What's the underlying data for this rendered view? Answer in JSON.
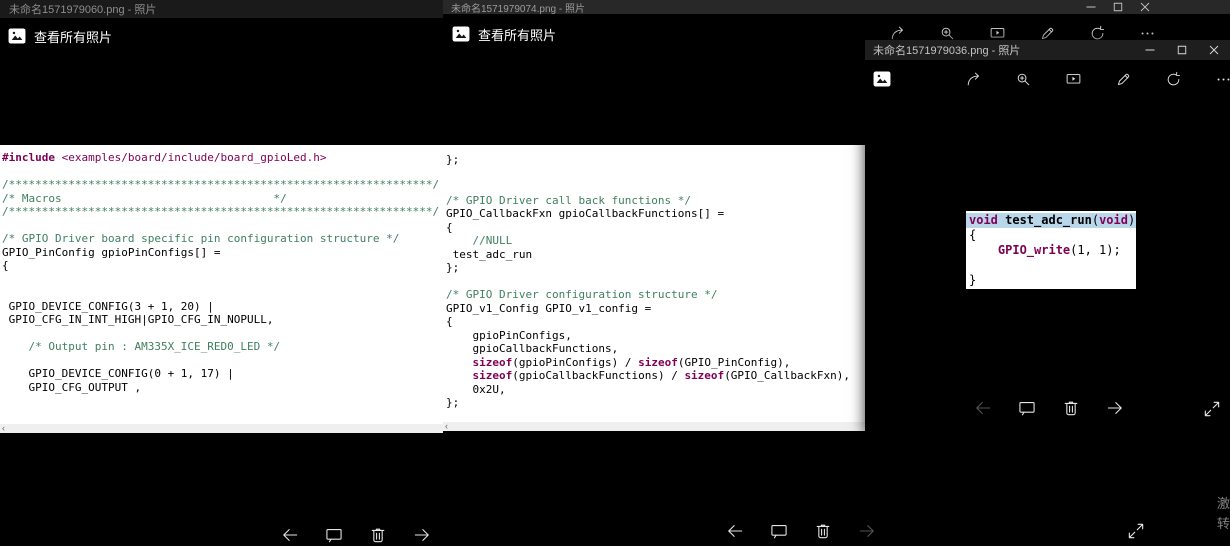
{
  "watermark": {
    "line1": "激活",
    "line2": "转到"
  },
  "colors": {
    "code_comment": "#3f7f5f",
    "code_keyword": "#7f0055",
    "code_plain": "#000000",
    "selection_highlight": "#b9d6ea",
    "photo_bg": "#ffffff",
    "app_bg": "#000000"
  },
  "win1": {
    "title": "未命名1571979060.png - 照片",
    "view_all_label": "查看所有照片",
    "bottom_icons": [
      {
        "n": "back"
      },
      {
        "n": "filmstrip"
      },
      {
        "n": "delete"
      },
      {
        "n": "forward"
      }
    ],
    "code": [
      [
        [
          "k",
          "#include"
        ],
        [
          "m",
          " <examples/board/include/board_gpioLed.h>"
        ]
      ],
      [],
      [
        [
          "c",
          "/****************************************************************/"
        ]
      ],
      [
        [
          "c",
          "/* Macros                                */"
        ]
      ],
      [
        [
          "c",
          "/****************************************************************/"
        ]
      ],
      [],
      [
        [
          "c",
          "/* GPIO Driver board specific pin configuration structure */"
        ]
      ],
      [
        [
          "p",
          "GPIO_PinConfig gpioPinConfigs[] ="
        ]
      ],
      [
        [
          "p",
          "{"
        ]
      ],
      [],
      [],
      [
        [
          "p",
          " GPIO_DEVICE_CONFIG(3 + 1, 20) |"
        ]
      ],
      [
        [
          "p",
          " GPIO_CFG_IN_INT_HIGH|GPIO_CFG_IN_NOPULL,"
        ]
      ],
      [],
      [
        [
          "c",
          "    /* Output pin : AM335X_ICE_RED0_LED */"
        ]
      ],
      [],
      [
        [
          "p",
          "    GPIO_DEVICE_CONFIG(0 + 1, 17) |"
        ]
      ],
      [
        [
          "p",
          "    GPIO_CFG_OUTPUT ,"
        ]
      ]
    ]
  },
  "win2": {
    "title": "未命名1571979074.png - 照片",
    "view_all_label": "查看所有照片",
    "caption_icons": [
      {
        "n": "minimize"
      },
      {
        "n": "maximize"
      },
      {
        "n": "close"
      }
    ],
    "toolbar_icons": [
      {
        "n": "share"
      },
      {
        "n": "zoom"
      },
      {
        "n": "slideshow"
      },
      {
        "n": "edit"
      },
      {
        "n": "rotate"
      },
      {
        "n": "more"
      }
    ],
    "bottom_icons": [
      {
        "n": "back"
      },
      {
        "n": "filmstrip"
      },
      {
        "n": "delete"
      },
      {
        "n": "forward",
        "disabled": true
      }
    ],
    "fullscreen_icon": [
      {
        "n": "fullscreen"
      }
    ],
    "code": [
      [
        [
          "p",
          "};"
        ]
      ],
      [],
      [],
      [
        [
          "c",
          "/* GPIO Driver call back functions */"
        ]
      ],
      [
        [
          "p",
          "GPIO_CallbackFxn gpioCallbackFunctions[] ="
        ]
      ],
      [
        [
          "p",
          "{"
        ]
      ],
      [
        [
          "c",
          "    //NULL"
        ]
      ],
      [
        [
          "p",
          " test_adc_run"
        ]
      ],
      [
        [
          "p",
          "};"
        ]
      ],
      [],
      [
        [
          "c",
          "/* GPIO Driver configuration structure */"
        ]
      ],
      [
        [
          "p",
          "GPIO_v1_Config GPIO_v1_config ="
        ]
      ],
      [
        [
          "p",
          "{"
        ]
      ],
      [
        [
          "p",
          "    gpioPinConfigs,"
        ]
      ],
      [
        [
          "p",
          "    gpioCallbackFunctions,"
        ]
      ],
      [
        [
          "p",
          "    "
        ],
        [
          "k",
          "sizeof"
        ],
        [
          "p",
          "(gpioPinConfigs) / "
        ],
        [
          "k",
          "sizeof"
        ],
        [
          "p",
          "(GPIO_PinConfig),"
        ]
      ],
      [
        [
          "p",
          "    "
        ],
        [
          "k",
          "sizeof"
        ],
        [
          "p",
          "(gpioCallbackFunctions) / "
        ],
        [
          "k",
          "sizeof"
        ],
        [
          "p",
          "(GPIO_CallbackFxn),"
        ]
      ],
      [
        [
          "p",
          "    0x2U,"
        ]
      ],
      [
        [
          "p",
          "};"
        ]
      ]
    ]
  },
  "win3": {
    "title": "未命名1571979036.png - 照片",
    "caption_icons": [
      {
        "n": "minimize"
      },
      {
        "n": "maximize"
      },
      {
        "n": "close"
      }
    ],
    "toolbar_icons": [
      {
        "n": "share"
      },
      {
        "n": "zoom"
      },
      {
        "n": "slideshow"
      },
      {
        "n": "edit"
      },
      {
        "n": "rotate"
      },
      {
        "n": "more"
      }
    ],
    "bottom_icons": [
      {
        "n": "back",
        "disabled": true
      },
      {
        "n": "filmstrip"
      },
      {
        "n": "delete"
      },
      {
        "n": "forward"
      }
    ],
    "fullscreen_icon": [
      {
        "n": "fullscreen"
      }
    ],
    "code": [
      {
        "hl": true,
        "s": [
          [
            "k",
            "void"
          ],
          [
            "b",
            " test_adc_run"
          ],
          [
            "p",
            "("
          ],
          [
            "k",
            "void"
          ],
          [
            "p",
            ")"
          ]
        ]
      },
      [
        [
          "p",
          "{"
        ]
      ],
      [
        [
          "p",
          "    "
        ],
        [
          "k",
          "GPIO_write"
        ],
        [
          "p",
          "(1, 1);"
        ]
      ],
      [],
      [
        [
          "p",
          "}"
        ]
      ]
    ]
  }
}
